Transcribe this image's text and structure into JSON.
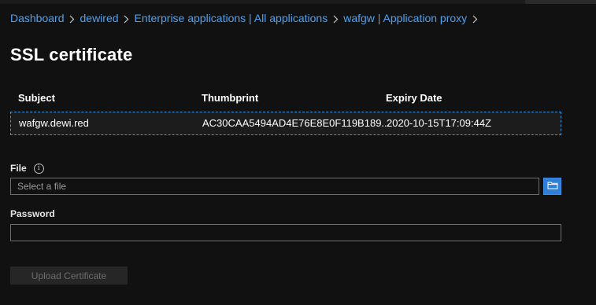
{
  "breadcrumb": {
    "items": [
      "Dashboard",
      "dewired",
      "Enterprise applications | All applications",
      "wafgw | Application proxy"
    ]
  },
  "page": {
    "title": "SSL certificate"
  },
  "certificate_table": {
    "columns": [
      "Subject",
      "Thumbprint",
      "Expiry Date"
    ],
    "rows": [
      [
        "wafgw.dewi.red",
        "AC30CAA5494AD4E76E8E0F119B189...",
        "2020-10-15T17:09:44Z"
      ]
    ]
  },
  "form": {
    "file": {
      "label": "File",
      "placeholder": "Select a file",
      "value": ""
    },
    "password": {
      "label": "Password",
      "value": ""
    },
    "upload_label": "Upload Certificate"
  },
  "icons": {
    "info": "info-icon",
    "browse": "folder-icon",
    "separator": "chevron-right-icon"
  },
  "colors": {
    "background": "#111111",
    "link": "#4ea1f0",
    "accent": "#2f7fd8",
    "selected_row_border": "#3a96dd",
    "disabled_text": "#6c6c6c"
  }
}
